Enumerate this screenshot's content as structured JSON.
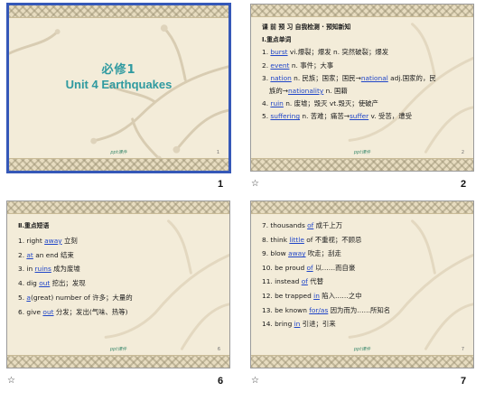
{
  "slides": {
    "s1": {
      "number": "1",
      "title_cn": "必修1",
      "title_en": "Unit 4    Earthquakes",
      "footer": "ppt课件",
      "page": "1"
    },
    "s2": {
      "number": "2",
      "header": "课 前 预 习    自我检测 · 预知新知",
      "subheader": "Ⅰ.重点单词",
      "items": [
        [
          "1. ",
          "burst",
          " vi.爆裂；爆发 n. 突然破裂；爆发",
          "",
          ""
        ],
        [
          "2. ",
          "event",
          " n. 事件；大事",
          "",
          ""
        ],
        [
          "3. ",
          "nation",
          " n. 民族；国家；国民→",
          "national",
          " adj.国家的，民"
        ],
        [
          "4. ",
          "ruin",
          " n. 废墟；毁灭 vt.毁灭；使破产",
          "",
          ""
        ],
        [
          "5. ",
          "suffering",
          " n. 苦难；痛苦→",
          "suffer",
          " v. 受苦，遭受"
        ]
      ],
      "item3_cont_pre": "族的→",
      "item3_cont_link": "nationality",
      "item3_cont_post": " n. 国籍",
      "footer": "ppt课件",
      "page": "2"
    },
    "s6": {
      "number": "6",
      "subheader": "Ⅱ.重点短语",
      "items": [
        [
          "1. right ",
          "away",
          " 立刻"
        ],
        [
          "2. ",
          "at",
          " an end 结束"
        ],
        [
          "3. in ",
          "ruins",
          " 成为废墟"
        ],
        [
          "4. dig ",
          "out",
          " 挖出；发现"
        ],
        [
          "5. ",
          "a",
          "(great) number of 许多；大量的"
        ],
        [
          "6. give ",
          "out",
          " 分发；发出(气味、热等)"
        ]
      ],
      "footer": "ppt课件",
      "page": "6"
    },
    "s7": {
      "number": "7",
      "items": [
        [
          "7. thousands ",
          "of",
          " 成千上万"
        ],
        [
          "8. think ",
          "little",
          " of 不重视；不顾忌"
        ],
        [
          "9. blow ",
          "away",
          " 吹走；刮走"
        ],
        [
          "10. be proud ",
          "of",
          " 以……而自豪"
        ],
        [
          "11. instead ",
          "of",
          " 代替"
        ],
        [
          "12. be trapped ",
          "in",
          " 陷入……之中"
        ],
        [
          "13. be known ",
          "for/as",
          " 因为而为……所知名"
        ],
        [
          "14. bring ",
          "in",
          " 引进；引来"
        ]
      ],
      "footer": "ppt课件",
      "page": "7"
    }
  }
}
